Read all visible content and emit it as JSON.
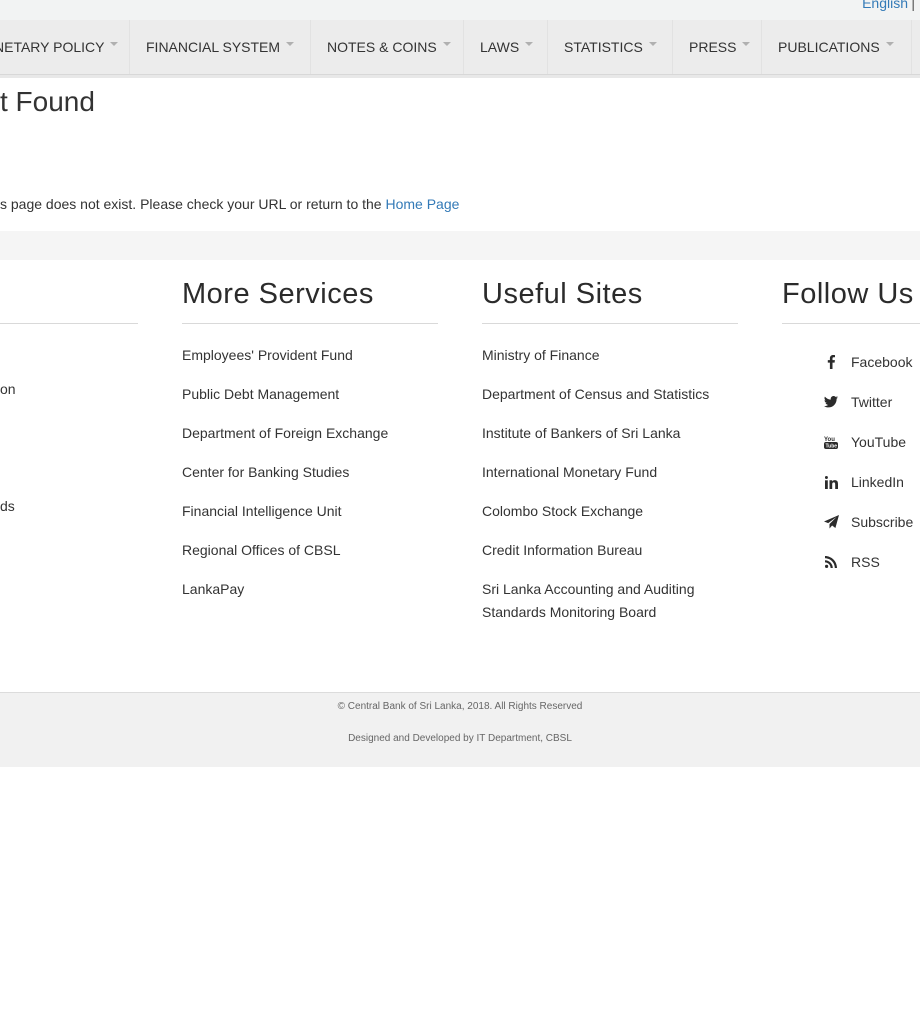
{
  "language": {
    "current": "English",
    "separator": "|"
  },
  "nav": {
    "items": [
      {
        "label": "NETARY POLICY"
      },
      {
        "label": "FINANCIAL SYSTEM"
      },
      {
        "label": "NOTES & COINS"
      },
      {
        "label": "LAWS"
      },
      {
        "label": "STATISTICS"
      },
      {
        "label": "PRESS"
      },
      {
        "label": "PUBLICATIONS"
      }
    ]
  },
  "error": {
    "title": "t Found",
    "message": "s page does not exist. Please check your URL or return to the ",
    "home_link": "Home Page"
  },
  "footer": {
    "left_partial": [
      "on",
      "ds"
    ],
    "more_services": {
      "title": "More Services",
      "items": [
        "Employees' Provident Fund",
        "Public Debt Management",
        "Department of Foreign Exchange",
        "Center for Banking Studies",
        "Financial Intelligence Unit",
        "Regional Offices of CBSL",
        "LankaPay"
      ]
    },
    "useful_sites": {
      "title": "Useful Sites",
      "items": [
        "Ministry of Finance",
        "Department of Census and Statistics",
        "Institute of Bankers of Sri Lanka",
        "International Monetary Fund",
        "Colombo Stock Exchange",
        "Credit Information Bureau",
        "Sri Lanka Accounting and Auditing Standards Monitoring Board"
      ]
    },
    "follow_us": {
      "title": "Follow Us",
      "items": [
        {
          "label": "Facebook",
          "icon": "facebook-icon"
        },
        {
          "label": "Twitter",
          "icon": "twitter-icon"
        },
        {
          "label": "YouTube",
          "icon": "youtube-icon"
        },
        {
          "label": "LinkedIn",
          "icon": "linkedin-icon"
        },
        {
          "label": "Subscribe",
          "icon": "paper-plane-icon"
        },
        {
          "label": "RSS",
          "icon": "rss-icon"
        }
      ]
    },
    "copyright": "© Central Bank of Sri Lanka, 2018. All Rights Reserved",
    "credits": "Designed and Developed by IT Department, CBSL"
  },
  "colors": {
    "link": "#337ab7",
    "nav_bg": "#ececec",
    "footer_bottom_bg": "#f1f1f1"
  }
}
